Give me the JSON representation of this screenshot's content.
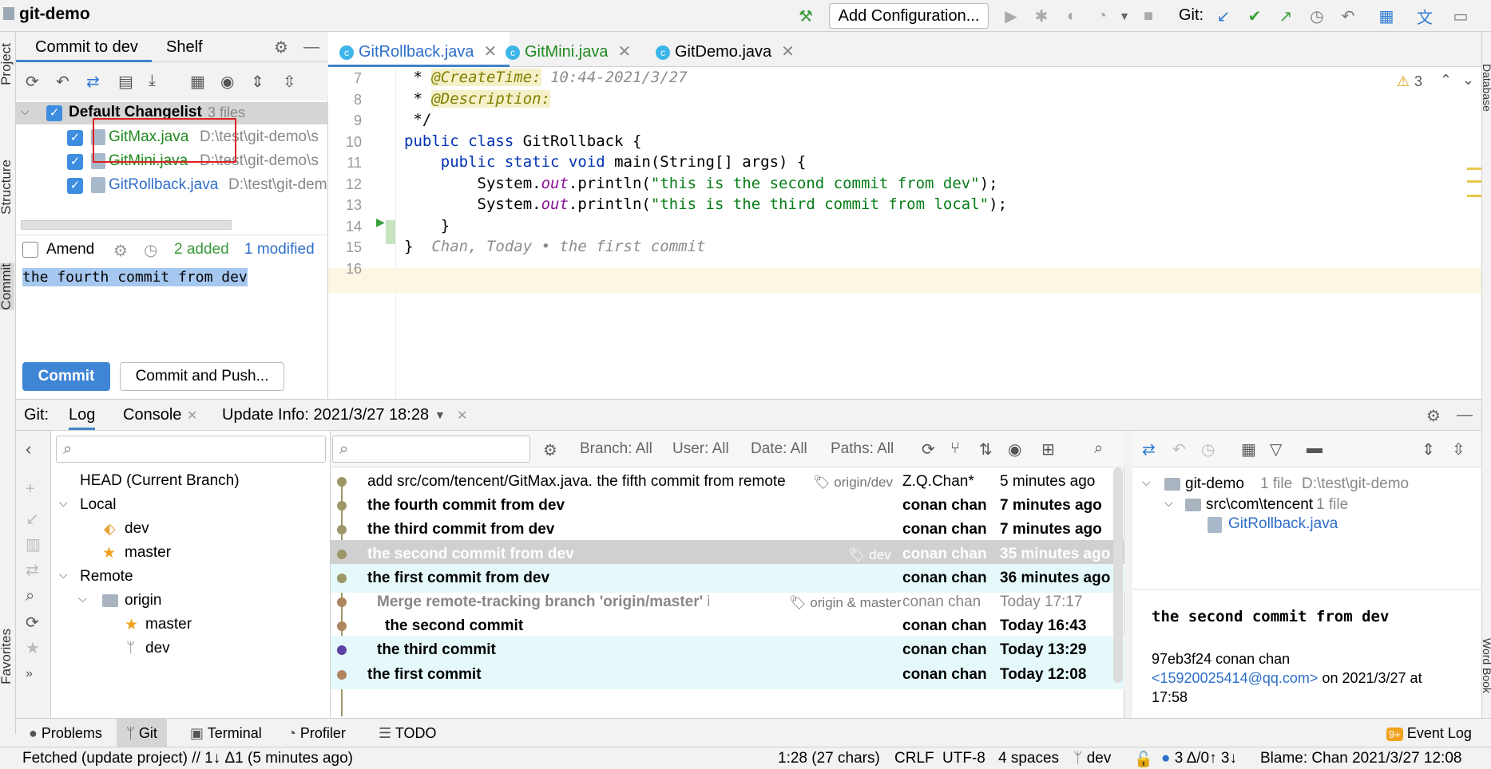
{
  "window": {
    "project_name": "git-demo"
  },
  "titlebar": {
    "add_configuration": "Add Configuration...",
    "git_label": "Git:"
  },
  "left_strip": {
    "project": "Project",
    "structure": "Structure",
    "commit": "Commit",
    "favorites": "Favorites"
  },
  "right_strip": {
    "database": "Database",
    "word_book": "Word Book"
  },
  "commit_panel": {
    "tab_commit": "Commit to dev",
    "tab_shelf": "Shelf",
    "changelist_name": "Default Changelist",
    "changelist_count": "3 files",
    "files": [
      {
        "name": "GitMax.java",
        "path": "D:\\test\\git-demo\\s"
      },
      {
        "name": "GitMini.java",
        "path": "D:\\test\\git-demo\\s"
      },
      {
        "name": "GitRollback.java",
        "path": "D:\\test\\git-dem"
      }
    ],
    "amend_label": "Amend",
    "added_count": "2 added",
    "modified_count": "1 modified",
    "commit_message": "the fourth  commit from dev",
    "commit_button": "Commit",
    "commit_push_button": "Commit and Push..."
  },
  "editor": {
    "tabs": [
      "GitRollback.java",
      "GitMini.java",
      "GitDemo.java"
    ],
    "warning_count": "3",
    "lines": [
      {
        "num": "7",
        "html": " * <span class='tag'>@CreateTime:</span> <span class='cm'>10:44-2021/3/27</span>"
      },
      {
        "num": "8",
        "html": " * <span class='tag'>@Description:</span>"
      },
      {
        "num": "9",
        "html": " */"
      },
      {
        "num": "10",
        "html": "<span class='kw'>public class</span> GitRollback {"
      },
      {
        "num": "11",
        "html": "    <span class='kw'>public static void</span> main(String[] args) {"
      },
      {
        "num": "12",
        "html": "        System.<span class='fld'>out</span>.println(<span class='str'>\"this is the second commit from dev\"</span>);"
      },
      {
        "num": "13",
        "html": "        System.<span class='fld'>out</span>.println(<span class='str'>\"this is the third commit from local\"</span>);"
      },
      {
        "num": "14",
        "html": "    }"
      },
      {
        "num": "15",
        "html": "}  <span class='cm'>Chan, Today • the first commit</span>"
      },
      {
        "num": "16",
        "html": ""
      }
    ]
  },
  "git_panel": {
    "label": "Git:",
    "tab_log": "Log",
    "tab_console": "Console",
    "tab_update": "Update Info: 2021/3/27 18:28",
    "filters": {
      "branch": "Branch: All",
      "user": "User: All",
      "date": "Date: All",
      "paths": "Paths: All"
    },
    "branches": {
      "head": "HEAD (Current Branch)",
      "local": "Local",
      "local_items": [
        "dev",
        "master"
      ],
      "remote": "Remote",
      "origin": "origin",
      "remote_items": [
        "master",
        "dev"
      ]
    },
    "log": [
      {
        "msg": "add src/com/tencent/GitMax.java. the fifth commit from remote",
        "ref": "origin/dev",
        "author": "Z.Q.Chan*",
        "date": "5 minutes ago",
        "bold": false
      },
      {
        "msg": "the fourth  commit from dev",
        "ref": "",
        "author": "conan chan",
        "date": "7 minutes ago",
        "bold": true
      },
      {
        "msg": "the third  commit from dev",
        "ref": "",
        "author": "conan chan",
        "date": "7 minutes ago",
        "bold": true
      },
      {
        "msg": "the second  commit from dev",
        "ref": "dev",
        "author": "conan chan",
        "date": "35 minutes ago",
        "bold": true,
        "selected": true
      },
      {
        "msg": "the first  commit from dev",
        "ref": "",
        "author": "conan chan",
        "date": "36 minutes ago",
        "bold": true,
        "hl": true
      },
      {
        "msg": "Merge remote-tracking branch 'origin/master' into ma",
        "ref": "origin & master",
        "author": "conan chan",
        "date": "Today 17:17",
        "bold": true,
        "grey": true
      },
      {
        "msg": "the second commit",
        "ref": "",
        "author": "conan chan",
        "date": "Today 16:43",
        "bold": true
      },
      {
        "msg": "the third commit",
        "ref": "",
        "author": "conan chan",
        "date": "Today 13:29",
        "bold": true,
        "hl": true
      },
      {
        "msg": "the first commit",
        "ref": "",
        "author": "conan chan",
        "date": "Today 12:08",
        "bold": true,
        "hl": true
      }
    ],
    "detail": {
      "root": "git-demo",
      "root_count": "1 file",
      "root_path": "D:\\test\\git-demo",
      "folder": "src\\com\\tencent",
      "folder_count": "1 file",
      "file": "GitRollback.java",
      "message": "the second  commit from dev",
      "hash_author": "97eb3f24 conan chan",
      "email": "<15920025414@qq.com>",
      "date_prefix": " on 2021/3/27 at",
      "time": "17:58"
    }
  },
  "bottom_tabs": {
    "problems": "Problems",
    "git": "Git",
    "terminal": "Terminal",
    "profiler": "Profiler",
    "todo": "TODO",
    "event_log": "Event Log",
    "event_badge": "9+"
  },
  "status": {
    "message": "Fetched (update project) // 1↓ Δ1 (5 minutes ago)",
    "position": "1:28 (27 chars)",
    "line_sep": "CRLF",
    "encoding": "UTF-8",
    "indent": "4 spaces",
    "branch": "dev",
    "changes": "3 Δ/0↑ 3↓",
    "blame": "Blame: Chan 2021/3/27 12:08"
  }
}
